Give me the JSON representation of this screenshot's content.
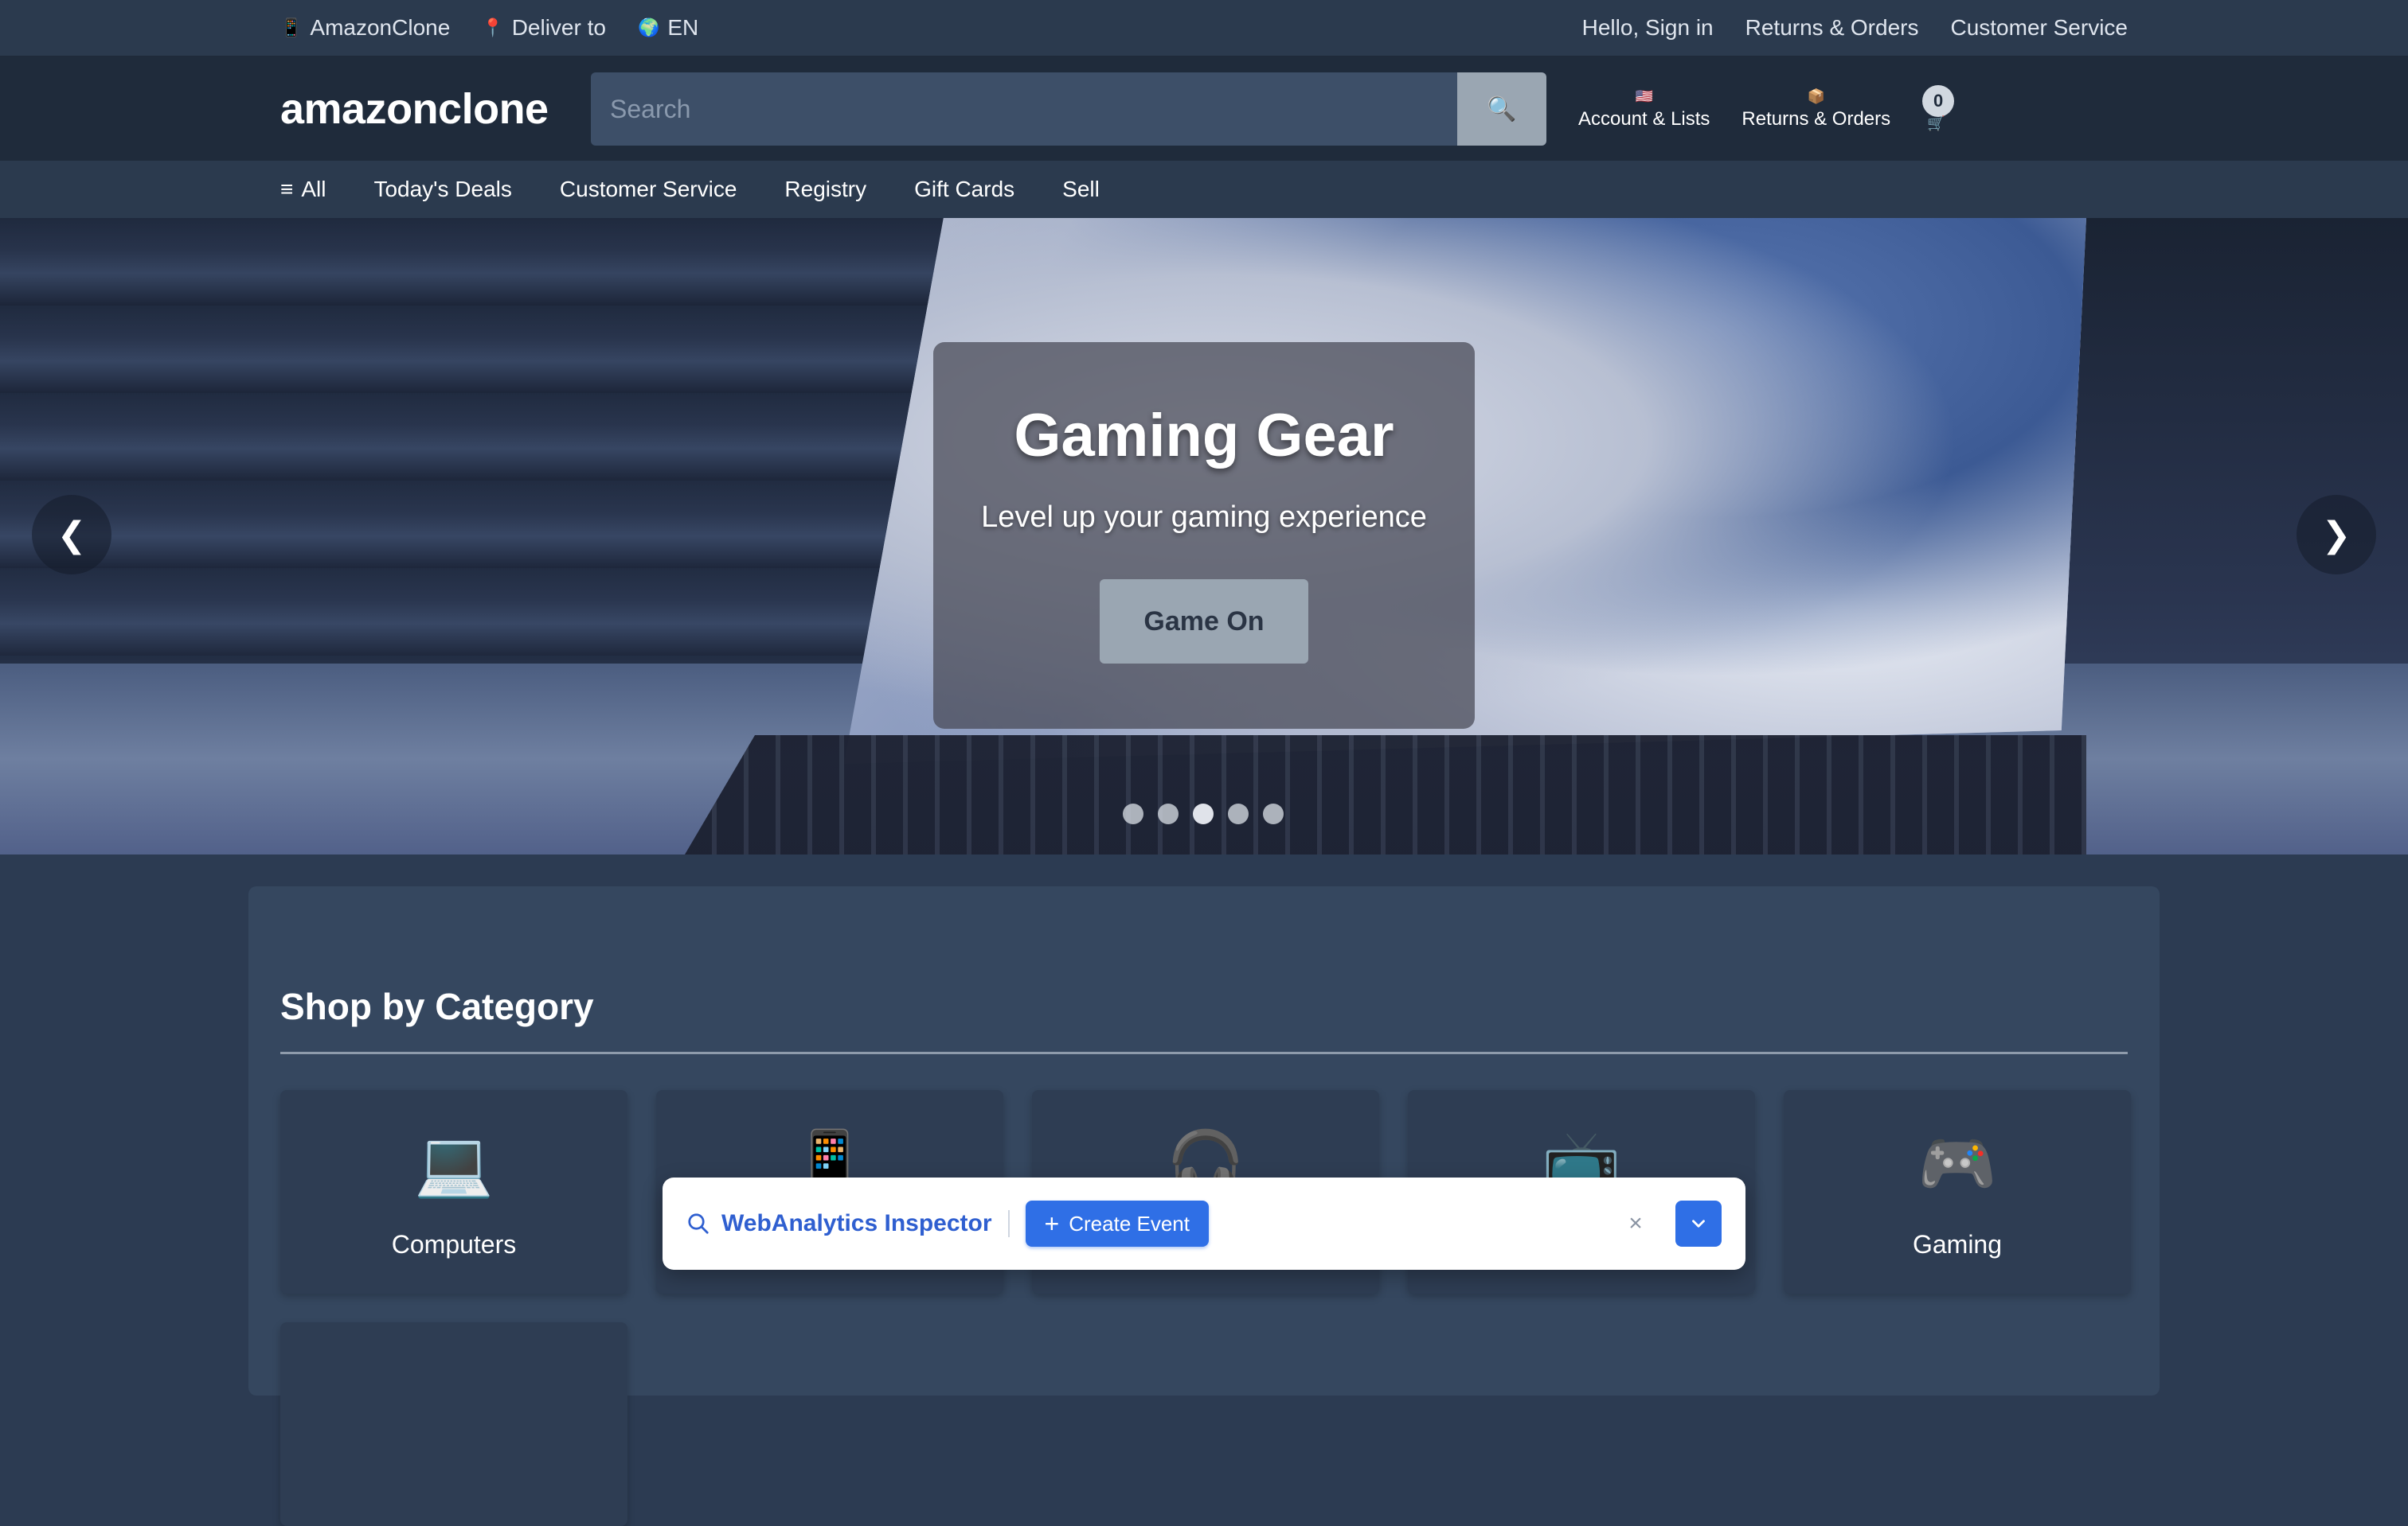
{
  "topbar": {
    "brand": {
      "icon": "phone-icon",
      "glyph": "📱",
      "label": "AmazonClone"
    },
    "deliver": {
      "icon": "pin-icon",
      "glyph": "📍",
      "label": "Deliver to"
    },
    "language": {
      "icon": "globe-icon",
      "glyph": "🌍",
      "label": "EN"
    },
    "links": [
      "Hello, Sign in",
      "Returns & Orders",
      "Customer Service"
    ]
  },
  "header": {
    "logo": "amazonclone",
    "search": {
      "placeholder": "Search",
      "value": "",
      "button_glyph": "🔍"
    },
    "account": {
      "glyph": "🇺🇸",
      "label": "Account & Lists"
    },
    "orders": {
      "glyph": "📦",
      "label": "Returns & Orders"
    },
    "cart": {
      "count": "0",
      "glyph": "🛒"
    }
  },
  "nav": {
    "all": {
      "glyph": "≡",
      "label": "All"
    },
    "items": [
      "Today's Deals",
      "Customer Service",
      "Registry",
      "Gift Cards",
      "Sell"
    ]
  },
  "hero": {
    "title": "Gaming Gear",
    "subtitle": "Level up your gaming experience",
    "cta": "Game On",
    "prev_glyph": "❮",
    "next_glyph": "❯",
    "slide_count": 5,
    "active_slide": 3
  },
  "categories": {
    "title": "Shop by Category",
    "items": [
      {
        "icon": "laptop-icon",
        "glyph": "💻",
        "label": "Computers"
      },
      {
        "icon": "phone-icon",
        "glyph": "📱",
        "label": ""
      },
      {
        "icon": "headphones-icon",
        "glyph": "🎧",
        "label": ""
      },
      {
        "icon": "tv-icon",
        "glyph": "📺",
        "label": ""
      },
      {
        "icon": "gamepad-icon",
        "glyph": "🎮",
        "label": "Gaming"
      }
    ]
  },
  "inspector": {
    "title": "WebAnalytics Inspector",
    "create_label": "Create Event",
    "close_glyph": "×",
    "accent": "#2f6fe6"
  },
  "colors": {
    "background": "#2c3b52",
    "header": "#1f2b3b",
    "button_gray": "#9aa6b2"
  }
}
